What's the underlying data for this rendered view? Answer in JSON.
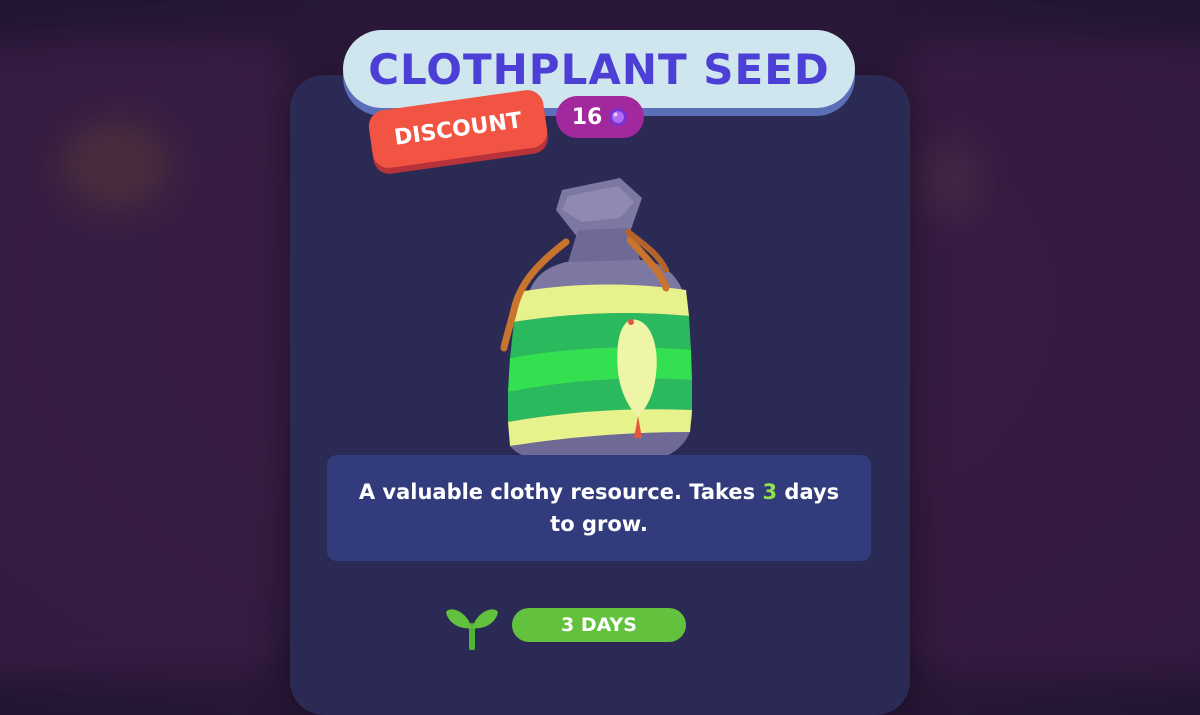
{
  "item": {
    "title": "CLOTHPLANT SEED",
    "discount_label": "DISCOUNT",
    "price": "16",
    "currency_icon": "gem-icon",
    "description": {
      "before": "A valuable clothy resource. Takes ",
      "highlight": "3",
      "after": " days to grow."
    },
    "grow_time": "3 DAYS",
    "grow_icon": "sprout-icon"
  },
  "colors": {
    "title_text": "#4b3fd6",
    "discount_badge": "#f25444",
    "price_badge": "#a2289e",
    "highlight": "#8fe24a",
    "days_pill": "#62c13d"
  }
}
